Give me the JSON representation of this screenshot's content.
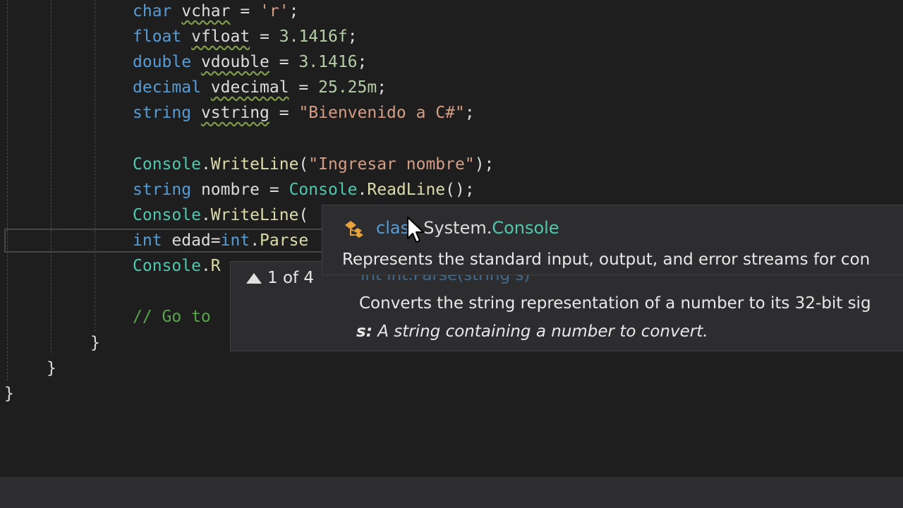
{
  "code": {
    "line1": {
      "kw": "char",
      "var": "vchar",
      "op": " = ",
      "val": "'r'",
      "end": ";"
    },
    "line2": {
      "kw": "float",
      "var": "vfloat",
      "op": " = ",
      "val": "3.1416f",
      "end": ";"
    },
    "line3": {
      "kw": "double",
      "var": "vdouble",
      "op": " = ",
      "val": "3.1416",
      "end": ";"
    },
    "line4": {
      "kw": "decimal",
      "var": "vdecimal",
      "op": " = ",
      "val": "25.25m",
      "end": ";"
    },
    "line5": {
      "kw": "string",
      "var": "vstring",
      "op": " = ",
      "val": "\"Bienvenido a C#\"",
      "end": ";"
    },
    "line6": {
      "cls": "Console",
      "dot": ".",
      "meth": "WriteLine",
      "open": "(",
      "str": "\"Ingresar nombre\"",
      "close": ");"
    },
    "line7": {
      "kw": "string",
      "rest": " nombre = ",
      "cls": "Console",
      "dot": ".",
      "meth": "ReadLine",
      "close": "();"
    },
    "line8": {
      "cls": "Console",
      "dot": ".",
      "meth": "WriteLine",
      "open": "("
    },
    "line9": {
      "kw": "int",
      "rest": " edad=",
      "kw2": "int",
      "dot": ".",
      "meth": "Parse"
    },
    "line10": {
      "cls": "Console",
      "dot": ".",
      "meth_partial": "R"
    },
    "line11": {
      "comment": "// Go to "
    },
    "braces": {
      "inner": "}",
      "middle": "}",
      "outer": "}"
    }
  },
  "quick_info": {
    "icon": "class-icon",
    "keyword": "class",
    "namespace": "System.",
    "class_name": "Console",
    "description": "Represents the standard input, output, and error streams for con"
  },
  "param_info": {
    "counter": "1 of 4",
    "signature": "int int.Parse(string s)",
    "description": "Converts the string representation of a number to its 32-bit sig",
    "param_name": "s:",
    "param_desc": " A string containing a number to convert."
  },
  "colors": {
    "background": "#1e1e1e",
    "keyword": "#569cd6",
    "string": "#d69d85",
    "class": "#4ec9b0",
    "method": "#dcdcaa",
    "comment": "#57a64a",
    "popup": "#2d2d30"
  }
}
